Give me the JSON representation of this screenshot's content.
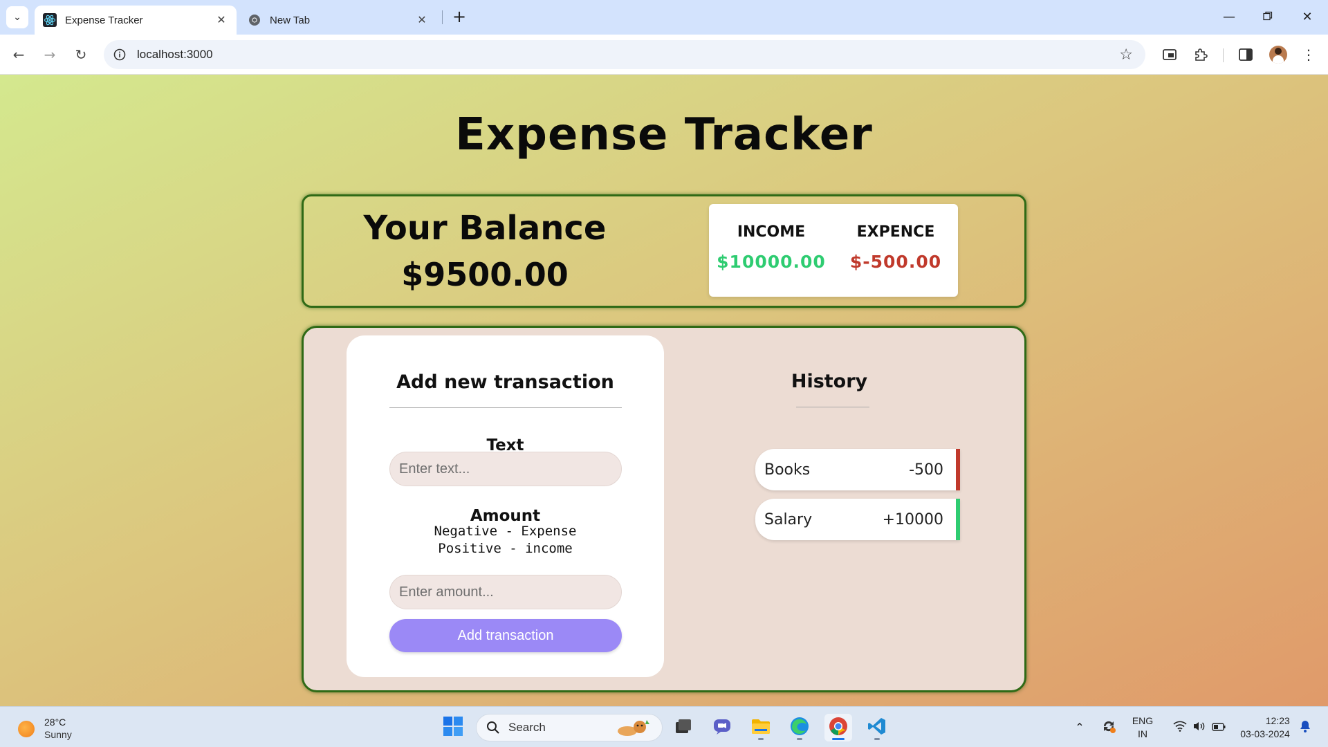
{
  "browser": {
    "tabs": [
      {
        "title": "Expense Tracker",
        "active": true,
        "icon": "react-icon"
      },
      {
        "title": "New Tab",
        "active": false,
        "icon": "chrome-icon"
      }
    ],
    "url": "localhost:3000"
  },
  "app": {
    "title": "Expense Tracker",
    "balance": {
      "label": "Your Balance",
      "value": "$9500.00"
    },
    "income": {
      "label": "INCOME",
      "value": "$10000.00"
    },
    "expense": {
      "label": "EXPENCE",
      "value": "$-500.00"
    },
    "form": {
      "title": "Add new transaction",
      "text_label": "Text",
      "text_placeholder": "Enter text...",
      "amount_label": "Amount",
      "hint_line1": "Negative - Expense",
      "hint_line2": "Positive - income",
      "amount_placeholder": "Enter amount...",
      "submit_label": "Add transaction"
    },
    "history": {
      "title": "History",
      "items": [
        {
          "text": "Books",
          "amount": "-500",
          "type": "expense"
        },
        {
          "text": "Salary",
          "amount": "+10000",
          "type": "income"
        }
      ]
    },
    "colors": {
      "income": "#2ecc71",
      "expense": "#c0392b",
      "accent": "#9b89f6",
      "border": "#2f6a16"
    }
  },
  "taskbar": {
    "weather": {
      "temp": "28°C",
      "desc": "Sunny"
    },
    "search_label": "Search",
    "language": {
      "line1": "ENG",
      "line2": "IN"
    },
    "clock": {
      "time": "12:23",
      "date": "03-03-2024"
    }
  }
}
